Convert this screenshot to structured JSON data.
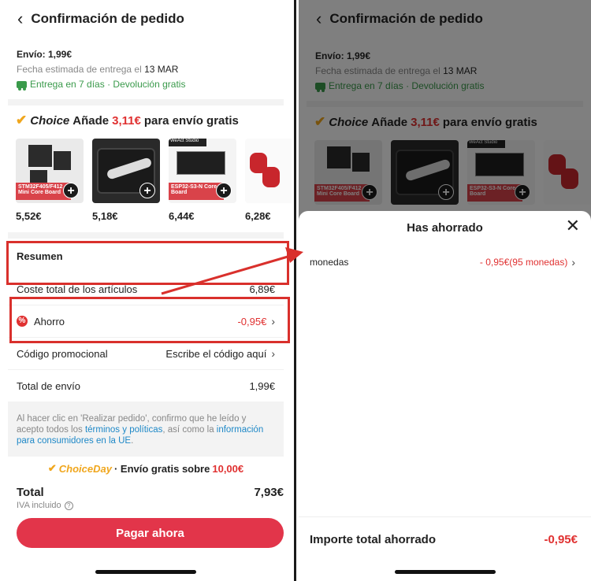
{
  "header": {
    "back_icon": "chevron-left-icon",
    "title": "Confirmación de pedido"
  },
  "shipping": {
    "cost": "Envío: 1,99€",
    "date_prefix": "Fecha estimada de entrega el",
    "date": "13 MAR",
    "delivery": "Entrega en 7 días · Devolución gratis"
  },
  "choice_banner": {
    "brand": "Choice",
    "prefix": "Añade",
    "amount": "3,11€",
    "suffix": "para envío gratis"
  },
  "products": [
    {
      "price": "5,52€",
      "label": "STM32F405/F412 Mini Core Board"
    },
    {
      "price": "5,18€"
    },
    {
      "price": "6,44€",
      "label": "ESP32-S3-N Core Board",
      "tag": "WeAct Studio"
    },
    {
      "price": "6,28€"
    }
  ],
  "summary": {
    "title": "Resumen",
    "rows": [
      {
        "label": "Coste total de los artículos",
        "value": "6,89€"
      },
      {
        "label": "Ahorro",
        "value": "-0,95€"
      },
      {
        "label": "Código promocional",
        "value": "Escribe el código aquí"
      },
      {
        "label": "Total de envío",
        "value": "1,99€"
      }
    ]
  },
  "legal": {
    "text1": "Al hacer clic en 'Realizar pedido', confirmo que he leído y acepto todos los ",
    "link1": "términos y políticas",
    "text2": ", así como la ",
    "link2": "información para consumidores en la UE",
    "text3": "."
  },
  "choiceday": {
    "brand_a": "Choice",
    "brand_b": "Day",
    "text": "· Envío gratis sobre",
    "amount": "10,00€"
  },
  "total": {
    "label": "Total",
    "value": "7,93€",
    "iva": "IVA incluido"
  },
  "pay_button": "Pagar ahora",
  "sheet": {
    "title": "Has ahorrado",
    "row_label": "monedas",
    "row_value": "- 0,95€(95 monedas)",
    "footer_label": "Importe total ahorrado",
    "footer_value": "-0,95€"
  },
  "colors": {
    "accent_red": "#e03131",
    "highlight_box": "#d9302c",
    "green": "#3a9a4b",
    "choice_gold": "#f0a61c",
    "pay_button": "#e2354a"
  }
}
